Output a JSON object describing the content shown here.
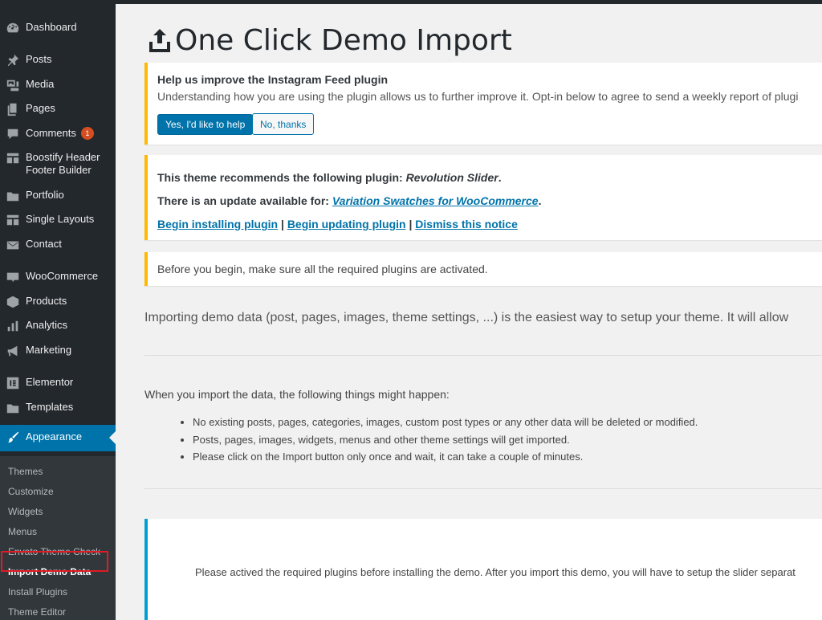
{
  "sidebar": {
    "items": [
      {
        "label": "Dashboard",
        "icon": "dashboard-icon"
      },
      {
        "label": "Posts",
        "icon": "pin-icon"
      },
      {
        "label": "Media",
        "icon": "media-icon"
      },
      {
        "label": "Pages",
        "icon": "pages-icon"
      },
      {
        "label": "Comments",
        "icon": "comment-icon",
        "badge": "1"
      },
      {
        "label": "Boostify Header Footer Builder",
        "icon": "layout-icon"
      },
      {
        "label": "Portfolio",
        "icon": "folder-icon"
      },
      {
        "label": "Single Layouts",
        "icon": "layout-icon"
      },
      {
        "label": "Contact",
        "icon": "email-icon"
      },
      {
        "label": "WooCommerce",
        "icon": "woo-icon"
      },
      {
        "label": "Products",
        "icon": "cube-icon"
      },
      {
        "label": "Analytics",
        "icon": "bar-chart-icon"
      },
      {
        "label": "Marketing",
        "icon": "megaphone-icon"
      },
      {
        "label": "Elementor",
        "icon": "elementor-icon"
      },
      {
        "label": "Templates",
        "icon": "folder-icon"
      },
      {
        "label": "Appearance",
        "icon": "brush-icon"
      }
    ],
    "submenu": [
      "Themes",
      "Customize",
      "Widgets",
      "Menus",
      "Envato Theme Check",
      "Import Demo Data",
      "Install Plugins",
      "Theme Editor"
    ]
  },
  "page": {
    "title": "One Click Demo Import"
  },
  "notice_instagram": {
    "title": "Help us improve the Instagram Feed plugin",
    "text": "Understanding how you are using the plugin allows us to further improve it. Opt-in below to agree to send a weekly report of plugi",
    "yes_button": "Yes, I'd like to help",
    "no_button": "No, thanks"
  },
  "notice_plugins": {
    "recommend_prefix": "This theme recommends the following plugin:",
    "recommend_plugin": "Revolution Slider",
    "update_prefix": "There is an update available for:",
    "update_plugin": "Variation Swatches for WooCommerce",
    "begin_installing": "Begin installing plugin",
    "begin_updating": "Begin updating plugin",
    "dismiss": "Dismiss this notice",
    "separator": "|"
  },
  "notice_before": {
    "text": "Before you begin, make sure all the required plugins are activated."
  },
  "intro": "Importing demo data (post, pages, images, theme settings, ...) is the easiest way to setup your theme. It will allow",
  "things_heading": "When you import the data, the following things might happen:",
  "things": [
    "No existing posts, pages, categories, images, custom post types or any other data will be deleted or modified.",
    "Posts, pages, images, widgets, menus and other theme settings will get imported.",
    "Please click on the Import button only once and wait, it can take a couple of minutes."
  ],
  "bottom_note": "Please actived the required plugins before installing the demo. After you import this demo, you will have to setup the slider separat"
}
